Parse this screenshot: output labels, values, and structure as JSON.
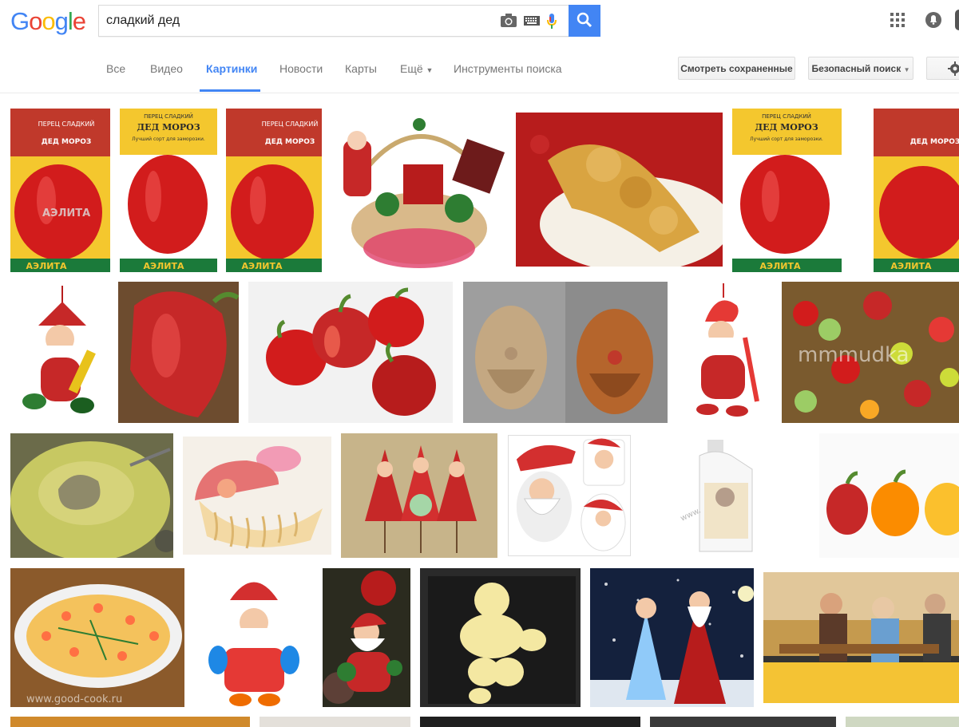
{
  "search": {
    "query": "сладкий дед"
  },
  "nav": {
    "tabs": [
      {
        "label": "Все"
      },
      {
        "label": "Видео"
      },
      {
        "label": "Картинки"
      },
      {
        "label": "Новости"
      },
      {
        "label": "Карты"
      },
      {
        "label": "Ещё"
      },
      {
        "label": "Инструменты поиска"
      }
    ],
    "saved_button": "Смотреть сохраненные",
    "safe_search_button": "Безопасный поиск"
  },
  "logo": {
    "text": "Google"
  },
  "tiles": {
    "t1": {
      "text1": "ПЕРЕЦ СЛАДКИЙ",
      "text2": "ДЕД МОРОЗ",
      "brand": "АЭЛИТА",
      "watermark": "АЭЛИТА"
    },
    "t2": {
      "text1": "ПЕРЕЦ СЛАДКИЙ",
      "text2": "ДЕД МОРОЗ",
      "sub": "Лучший сорт для заморозки.",
      "brand": "АЭЛИТА"
    },
    "t3": {
      "text1": "ПЕРЕЦ СЛАДКИЙ",
      "text2": "ДЕД МОРОЗ",
      "brand": "АЭЛИТА"
    },
    "t6": {
      "text1": "ПЕРЕЦ СЛАДКИЙ",
      "text2": "ДЕД МОРОЗ",
      "sub": "Лучший сорт для заморозки.",
      "brand": "АЭЛИТА"
    },
    "t7": {
      "text2": "ДЕД МОРОЗ",
      "brand": "АЭЛИТА"
    },
    "t13": {
      "watermark": "mmmudka"
    },
    "t18": {
      "watermark": "www."
    },
    "t21": {
      "watermark": "www.good-cook.ru"
    }
  },
  "colors": {
    "accent": "#4285f4",
    "pepper": "#d21c1c",
    "card_yellow": "#f4c72e"
  }
}
